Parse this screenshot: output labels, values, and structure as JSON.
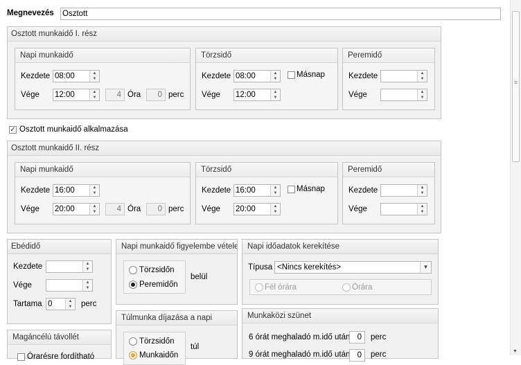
{
  "name_label": "Megnevezés",
  "name_value": "Osztott",
  "part1": {
    "title": "Osztott munkaidő I. rész",
    "napi": {
      "title": "Napi munkaidő",
      "start_label": "Kezdete",
      "start": "08:00",
      "end_label": "Vége",
      "end": "12:00",
      "hours": "4",
      "hours_unit": "Óra",
      "minutes": "0",
      "minutes_unit": "perc"
    },
    "torzs": {
      "title": "Törzsidő",
      "start_label": "Kezdete",
      "start": "08:00",
      "end_label": "Vége",
      "end": "12:00",
      "next_day_label": "Másnap",
      "next_day": false
    },
    "perem": {
      "title": "Peremidő",
      "start_label": "Kezdete",
      "start": "",
      "end_label": "Vége",
      "end": ""
    }
  },
  "apply_label": "Osztott munkaidő alkalmazása",
  "apply_checked": true,
  "part2": {
    "title": "Osztott munkaidő II. rész",
    "napi": {
      "title": "Napi munkaidő",
      "start_label": "Kezdete",
      "start": "16:00",
      "end_label": "Vége",
      "end": "20:00",
      "hours": "4",
      "hours_unit": "Óra",
      "minutes": "0",
      "minutes_unit": "perc"
    },
    "torzs": {
      "title": "Törzsidő",
      "start_label": "Kezdete",
      "start": "16:00",
      "end_label": "Vége",
      "end": "20:00",
      "next_day_label": "Másnap",
      "next_day": false
    },
    "perem": {
      "title": "Peremidő",
      "start_label": "Kezdete",
      "start": "",
      "end_label": "Vége",
      "end": ""
    }
  },
  "lunch": {
    "title": "Ebédidő",
    "start_label": "Kezdete",
    "start": "",
    "end_label": "Vége",
    "end": "",
    "duration_label": "Tartama",
    "duration": "0",
    "duration_unit": "perc"
  },
  "consider": {
    "title": "Napi munkaidő figyelembe vétele",
    "option1": "Törzsidőn",
    "option2": "Peremidőn",
    "selected": "Peremidőn",
    "suffix": "belül"
  },
  "rounding": {
    "title": "Napi időadatok kerekítése",
    "type_label": "Típusa",
    "type_value": "<Nincs kerekítés>",
    "option1": "Fél órára",
    "option2": "Órára"
  },
  "overtime": {
    "title": "Túlmunka díjazása a napi",
    "option1": "Törzsidőn",
    "option2": "Munkaidőn",
    "selected": "Munkaidőn",
    "suffix": "túl"
  },
  "breaks": {
    "title": "Munkaközi szünet",
    "row1_label": "6 órát meghaladó m.idő után",
    "row1_value": "0",
    "row1_unit": "perc",
    "row2_label": "9 órát meghaladó m.idő után",
    "row2_value": "0",
    "row2_unit": "perc"
  },
  "private": {
    "title": "Magáncélú távollét",
    "checkbox_label": "Órarésre fordítható",
    "checked": false
  }
}
